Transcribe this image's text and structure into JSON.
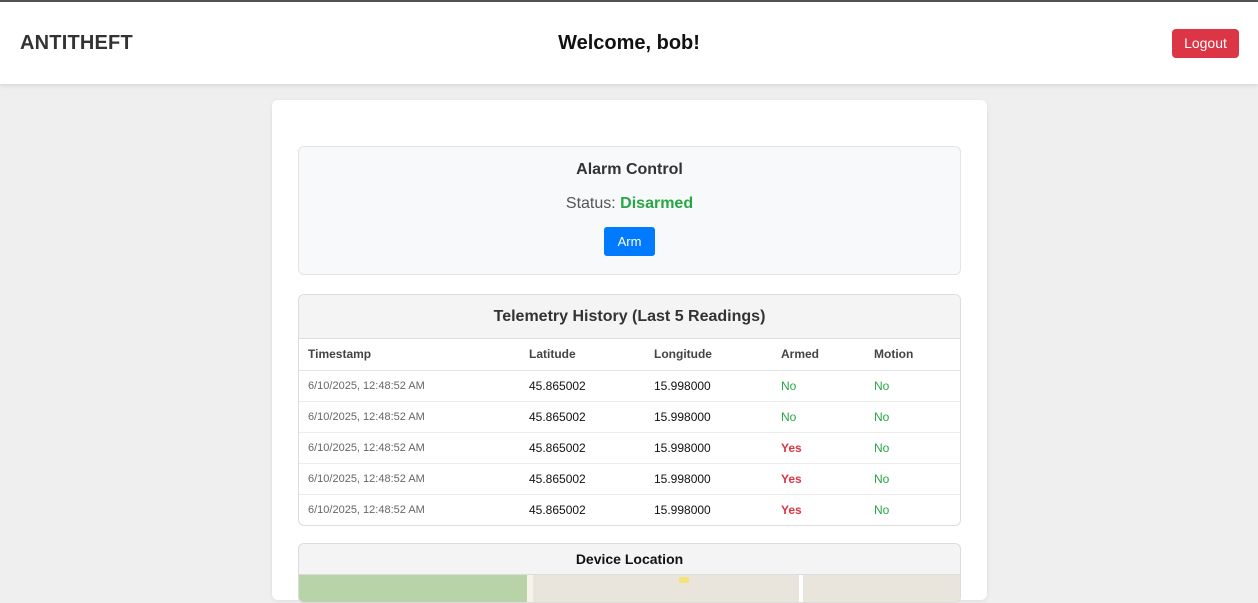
{
  "header": {
    "brand": "ANTITHEFT",
    "welcome": "Welcome, bob!",
    "logout_label": "Logout"
  },
  "alarm": {
    "title": "Alarm Control",
    "status_label": "Status:",
    "status_value": "Disarmed",
    "arm_label": "Arm"
  },
  "telemetry": {
    "title": "Telemetry History (Last 5 Readings)",
    "columns": [
      "Timestamp",
      "Latitude",
      "Longitude",
      "Armed",
      "Motion"
    ],
    "rows": [
      {
        "timestamp": "6/10/2025, 12:48:52 AM",
        "latitude": "45.865002",
        "longitude": "15.998000",
        "armed": "No",
        "motion": "No"
      },
      {
        "timestamp": "6/10/2025, 12:48:52 AM",
        "latitude": "45.865002",
        "longitude": "15.998000",
        "armed": "No",
        "motion": "No"
      },
      {
        "timestamp": "6/10/2025, 12:48:52 AM",
        "latitude": "45.865002",
        "longitude": "15.998000",
        "armed": "Yes",
        "motion": "No"
      },
      {
        "timestamp": "6/10/2025, 12:48:52 AM",
        "latitude": "45.865002",
        "longitude": "15.998000",
        "armed": "Yes",
        "motion": "No"
      },
      {
        "timestamp": "6/10/2025, 12:48:52 AM",
        "latitude": "45.865002",
        "longitude": "15.998000",
        "armed": "Yes",
        "motion": "No"
      }
    ]
  },
  "location": {
    "title": "Device Location"
  },
  "colors": {
    "danger": "#dc3545",
    "primary": "#007bff",
    "success": "#28a745"
  }
}
